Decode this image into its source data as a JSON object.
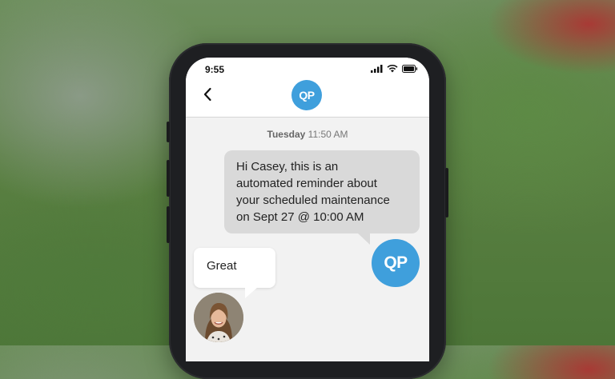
{
  "status_bar": {
    "time": "9:55"
  },
  "header": {
    "back_icon": "chevron-left-icon",
    "avatar_initials": "QP"
  },
  "conversation": {
    "timestamp_day": "Tuesday",
    "timestamp_time": "11:50 AM",
    "messages": [
      {
        "from": "business",
        "avatar_initials": "QP",
        "lines": [
          "Hi Casey, this is an",
          "automated reminder about",
          "your scheduled maintenance",
          "on Sept 27 @ 10:00 AM"
        ]
      },
      {
        "from": "customer",
        "text": "Great"
      }
    ]
  },
  "colors": {
    "brand": "#3f9fdc",
    "outgoing_bubble": "#d9d9d9",
    "incoming_bubble": "#ffffff"
  }
}
